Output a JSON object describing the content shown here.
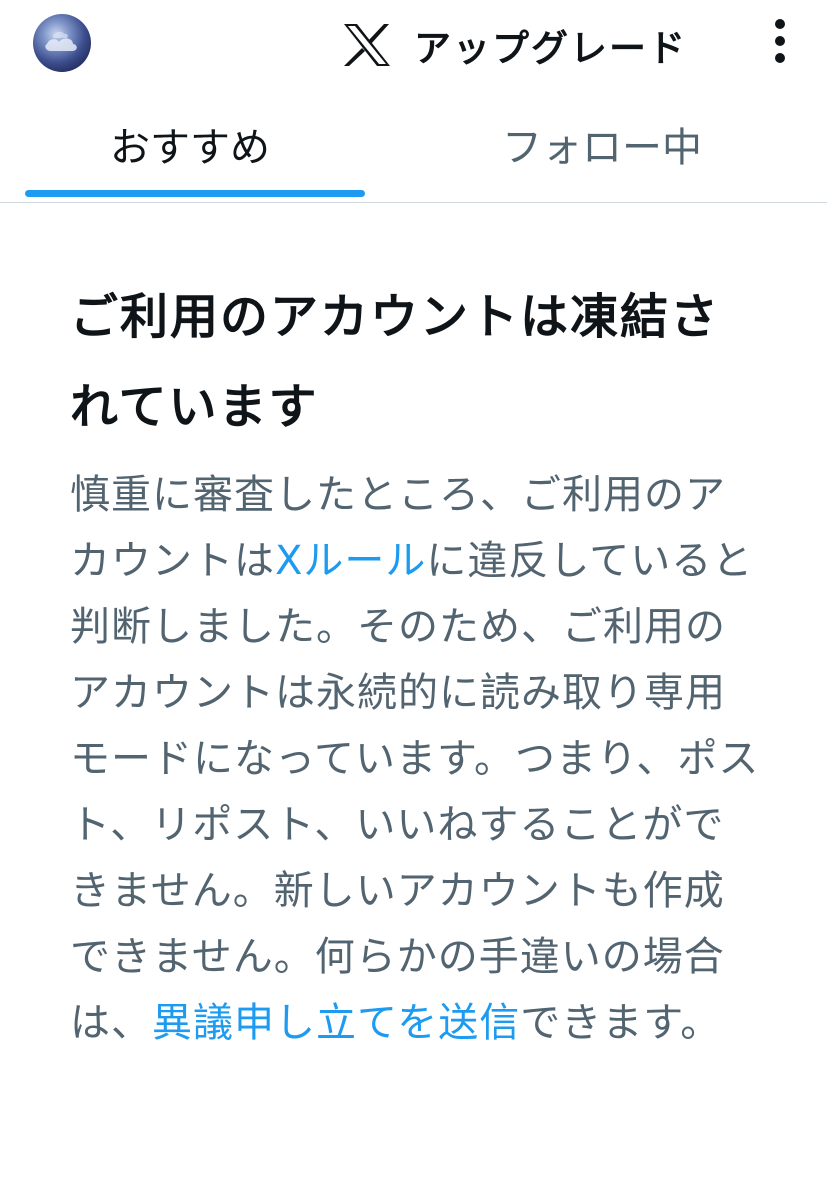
{
  "header": {
    "avatar_icon": "avatar-icon",
    "logo_icon": "x-logo-icon",
    "upgrade_label": "アップグレード",
    "more_icon": "kebab-menu-icon"
  },
  "tabs": {
    "for_you": "おすすめ",
    "following": "フォロー中",
    "active": "for_you"
  },
  "notice": {
    "title": "ご利用のアカウントは凍結されています",
    "body_part1": "慎重に審査したところ、ご利用のアカウントは",
    "rules_link": "Xルール",
    "body_part2": "に違反していると判断しました。そのため、ご利用のアカウントは永続的に読み取り専用モードになっています。つまり、ポスト、リポスト、いいねすることができません。新しいアカウントも作成できません。何らかの手違いの場合は、",
    "appeal_link": "異議申し立てを送信",
    "body_part3": "できます。"
  },
  "colors": {
    "accent": "#1d9bf0",
    "text_primary": "#0f1419",
    "text_secondary": "#536471",
    "divider": "#cfd9de"
  }
}
